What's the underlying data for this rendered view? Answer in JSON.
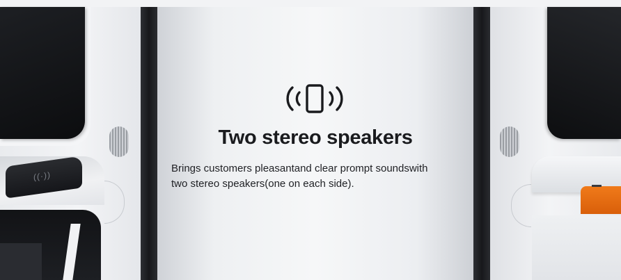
{
  "feature": {
    "icon": "vibrating-phone-speaker-icon",
    "title": "Two stereo speakers",
    "description_line1": "Brings customers pleasantand clear prompt soundswith",
    "description_line2": "two stereo speakers(one on each side)."
  },
  "kiosk_left": {
    "reader_glyph": "((·))"
  },
  "colors": {
    "title": "#1a1b1e",
    "text": "#1f2024",
    "accent_printer": "#e56a12",
    "kiosk_dark": "#15161a",
    "kiosk_light": "#f3f4f6"
  }
}
